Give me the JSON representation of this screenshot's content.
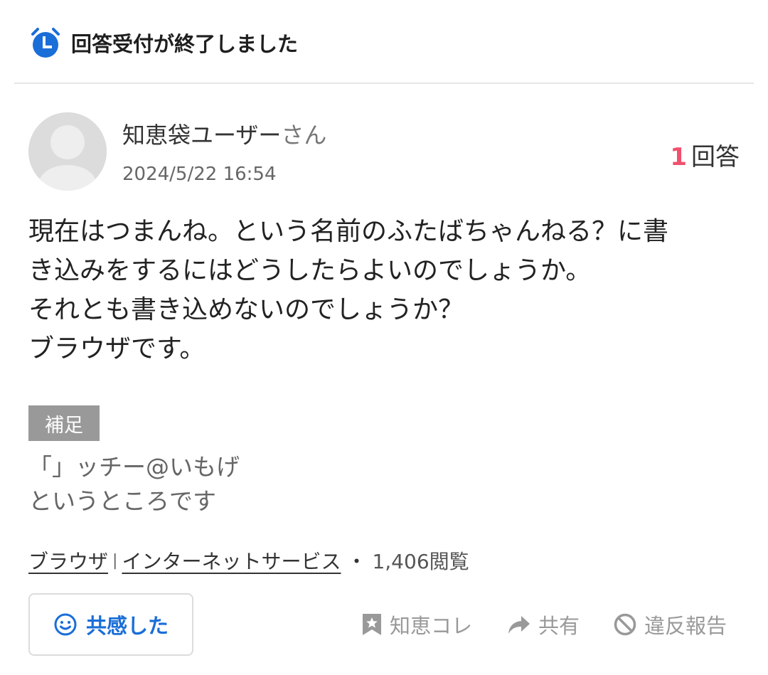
{
  "status": {
    "text": "回答受付が終了しました",
    "icon": "alarm-clock-icon",
    "icon_color": "#1a6ed8"
  },
  "question": {
    "user_name": "知恵袋ユーザー",
    "user_suffix": "さん",
    "posted_at": "2024/5/22 16:54",
    "answer_count": "1",
    "answer_label": "回答",
    "body_lines": [
      "現在はつまんね。という名前のふたばちゃんねる？に書",
      "き込みをするにはどうしたらよいのでしょうか。",
      "それとも書き込めないのでしょうか？",
      "ブラウザです。"
    ]
  },
  "supplement": {
    "badge": "補足",
    "lines": [
      "「」ッチー@いもげ",
      "というところです"
    ]
  },
  "meta": {
    "category_1": "ブラウザ",
    "separator": "|",
    "category_2": "インターネットサービス",
    "dot": "・",
    "views": "1,406閲覧"
  },
  "actions": {
    "empathy_label": "共感した",
    "save_label": "知恵コレ",
    "share_label": "共有",
    "report_label": "違反報告"
  },
  "colors": {
    "accent_blue": "#1a6ed8",
    "answer_count_red": "#f0506e",
    "muted_gray": "#999999"
  }
}
